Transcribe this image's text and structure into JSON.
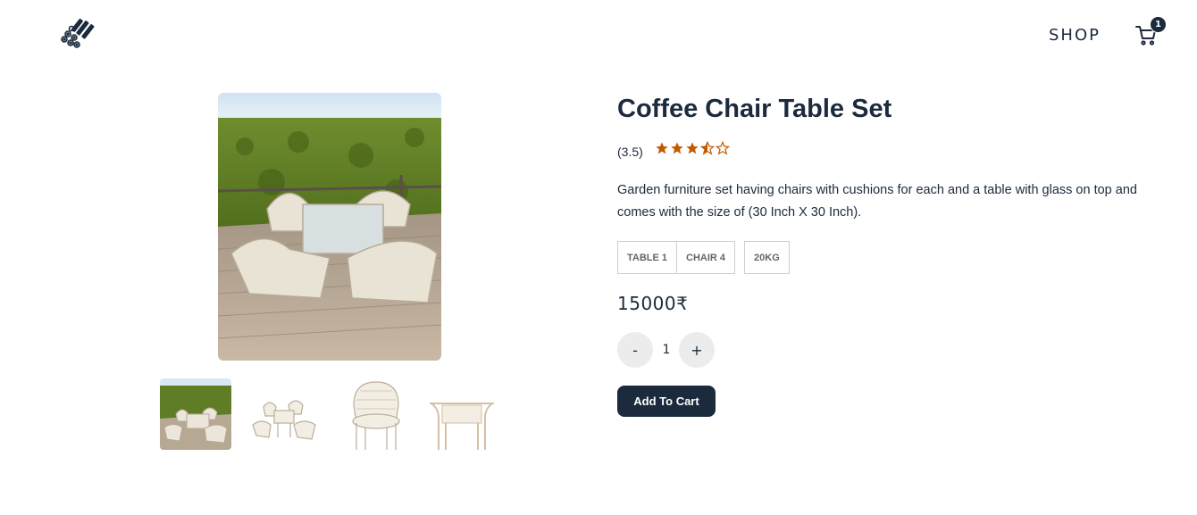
{
  "header": {
    "logo_icon": "logs-logo-icon",
    "nav_shop": "SHOP",
    "cart_icon": "shopping-cart-icon",
    "cart_count": "1"
  },
  "product": {
    "title": "Coffee Chair Table Set",
    "rating_text": "(3.5)",
    "rating_value": 3.5,
    "rating_max": 5,
    "star_color": "#c15a00",
    "description": "Garden furniture set having chairs with cushions for each and a table with glass on top and comes with the size of (30 Inch X 30 Inch).",
    "tags": [
      "TABLE 1",
      "CHAIR 4",
      "20KG"
    ],
    "price": "15000₹",
    "quantity": "1",
    "qty_minus": "-",
    "qty_plus": "+",
    "add_to_cart": "Add To Cart"
  },
  "gallery": {
    "main_image": "outdoor-wicker-furniture-on-deck-photo",
    "thumbnails": [
      "set-on-deck-photo",
      "set-white-background-photo",
      "chair-photo",
      "table-photo"
    ]
  },
  "colors": {
    "primary": "#1b2a3d",
    "button_bg": "#ececec"
  }
}
